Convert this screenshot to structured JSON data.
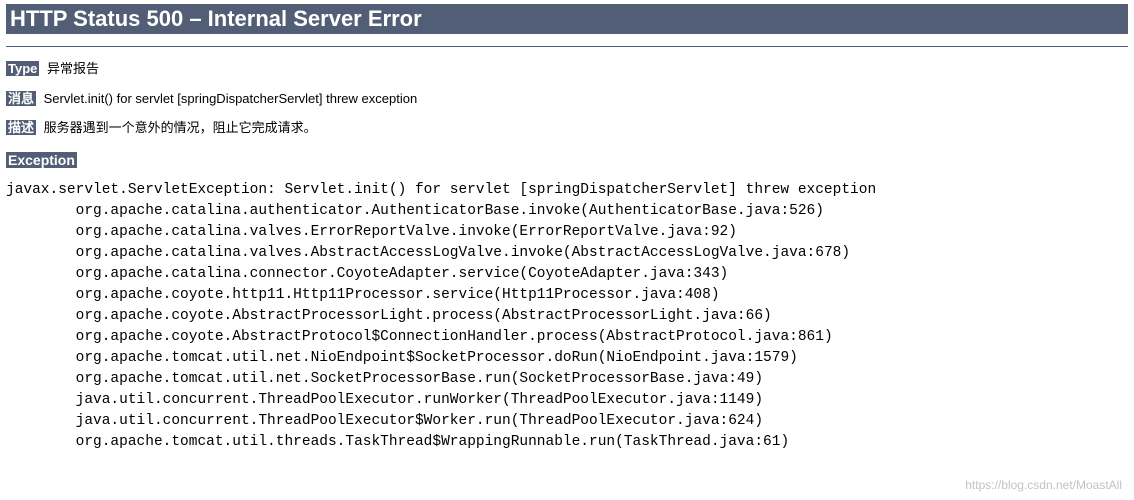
{
  "header": {
    "title": "HTTP Status 500 – Internal Server Error"
  },
  "type_section": {
    "label": "Type",
    "value": "异常报告"
  },
  "message_section": {
    "label": "消息",
    "value": "Servlet.init() for servlet [springDispatcherServlet] threw exception"
  },
  "description_section": {
    "label": "描述",
    "value": "服务器遇到一个意外的情况，阻止它完成请求。"
  },
  "exception_section": {
    "label": "Exception"
  },
  "stack_trace": "javax.servlet.ServletException: Servlet.init() for servlet [springDispatcherServlet] threw exception\n\torg.apache.catalina.authenticator.AuthenticatorBase.invoke(AuthenticatorBase.java:526)\n\torg.apache.catalina.valves.ErrorReportValve.invoke(ErrorReportValve.java:92)\n\torg.apache.catalina.valves.AbstractAccessLogValve.invoke(AbstractAccessLogValve.java:678)\n\torg.apache.catalina.connector.CoyoteAdapter.service(CoyoteAdapter.java:343)\n\torg.apache.coyote.http11.Http11Processor.service(Http11Processor.java:408)\n\torg.apache.coyote.AbstractProcessorLight.process(AbstractProcessorLight.java:66)\n\torg.apache.coyote.AbstractProtocol$ConnectionHandler.process(AbstractProtocol.java:861)\n\torg.apache.tomcat.util.net.NioEndpoint$SocketProcessor.doRun(NioEndpoint.java:1579)\n\torg.apache.tomcat.util.net.SocketProcessorBase.run(SocketProcessorBase.java:49)\n\tjava.util.concurrent.ThreadPoolExecutor.runWorker(ThreadPoolExecutor.java:1149)\n\tjava.util.concurrent.ThreadPoolExecutor$Worker.run(ThreadPoolExecutor.java:624)\n\torg.apache.tomcat.util.threads.TaskThread$WrappingRunnable.run(TaskThread.java:61)",
  "watermark": "https://blog.csdn.net/MoastAll"
}
